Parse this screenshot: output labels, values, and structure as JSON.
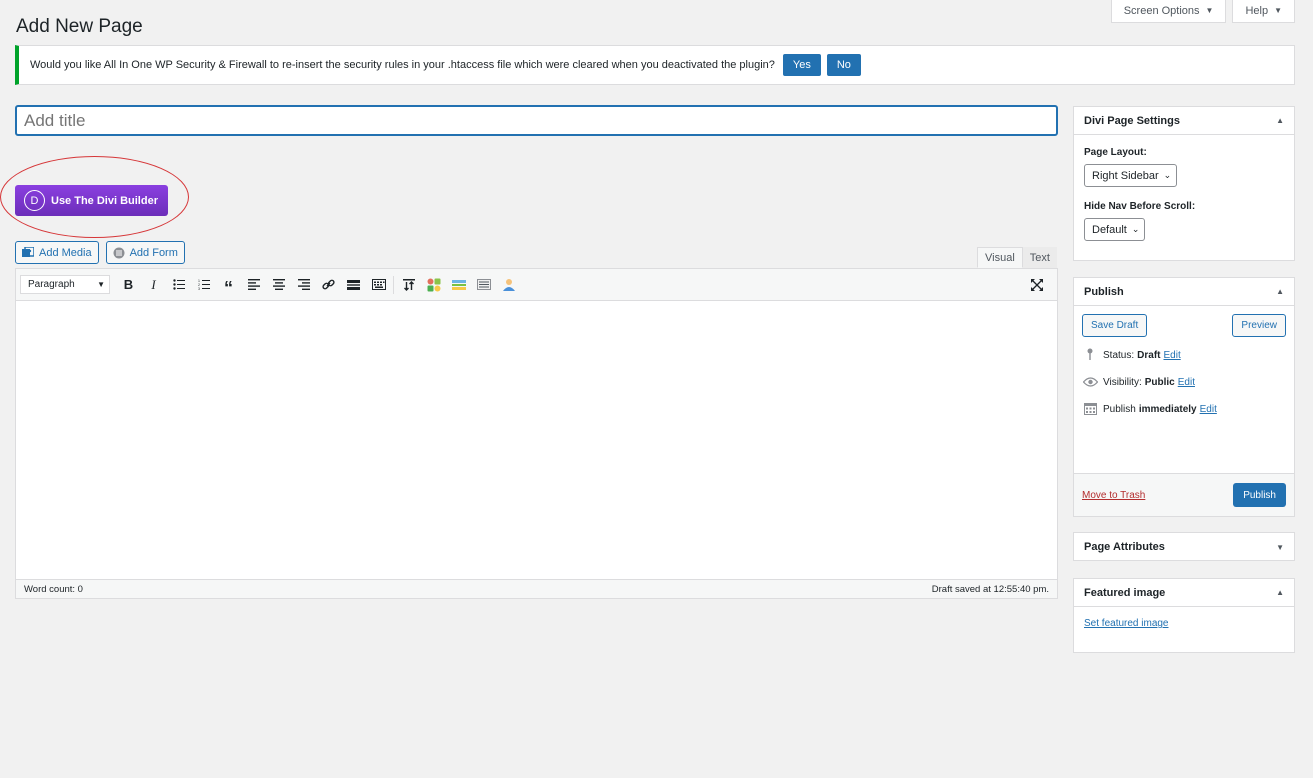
{
  "page": {
    "title": "Add New Page"
  },
  "top_tabs": {
    "screen_options": "Screen Options",
    "help": "Help"
  },
  "notice": {
    "message": "Would you like All In One WP Security & Firewall to re-insert the security rules in your .htaccess file which were cleared when you deactivated the plugin?",
    "yes_label": "Yes",
    "no_label": "No"
  },
  "title_field": {
    "placeholder": "Add title"
  },
  "divi": {
    "button_label": "Use The Divi Builder",
    "logo_letter": "D"
  },
  "media": {
    "add_media": "Add Media",
    "add_form": "Add Form"
  },
  "editor": {
    "tabs": {
      "visual": "Visual",
      "text": "Text"
    },
    "format_select": "Paragraph",
    "word_count": "Word count: 0",
    "draft_saved": "Draft saved at 12:55:40 pm."
  },
  "divi_settings": {
    "title": "Divi Page Settings",
    "layout_label": "Page Layout:",
    "layout_value": "Right Sidebar",
    "hide_nav_label": "Hide Nav Before Scroll:",
    "hide_nav_value": "Default"
  },
  "publish": {
    "title": "Publish",
    "save_draft": "Save Draft",
    "preview": "Preview",
    "status_label": "Status:",
    "status_value": "Draft",
    "visibility_label": "Visibility:",
    "visibility_value": "Public",
    "publish_label": "Publish",
    "publish_value": "immediately",
    "edit": "Edit",
    "move_to_trash": "Move to Trash",
    "publish_button": "Publish"
  },
  "page_attributes": {
    "title": "Page Attributes"
  },
  "featured_image": {
    "title": "Featured image",
    "set_link": "Set featured image"
  },
  "colors": {
    "primary": "#2271b1",
    "divi_purple": "#7e3bd0",
    "notice_green": "#00a32a",
    "highlight_red": "#d63638"
  }
}
